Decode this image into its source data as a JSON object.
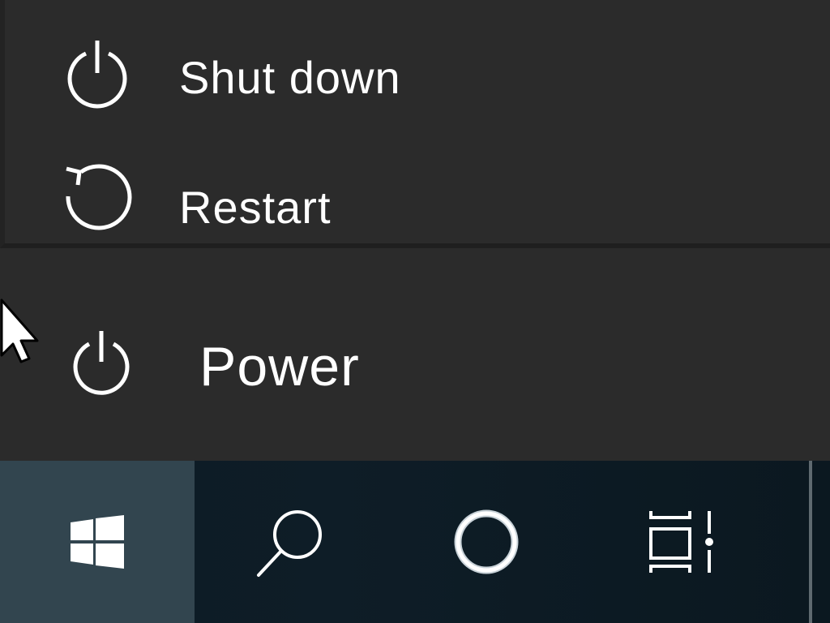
{
  "flyout": {
    "items": [
      {
        "label": "Shut down",
        "icon": "power-icon"
      },
      {
        "label": "Restart",
        "icon": "restart-icon"
      }
    ]
  },
  "start_menu": {
    "power": {
      "label": "Power",
      "icon": "power-icon"
    }
  },
  "taskbar": {
    "buttons": [
      {
        "name": "start",
        "icon": "windows-logo-icon"
      },
      {
        "name": "search",
        "icon": "search-icon"
      },
      {
        "name": "cortana",
        "icon": "cortana-ring-icon"
      },
      {
        "name": "task-view",
        "icon": "task-view-icon"
      }
    ]
  },
  "colors": {
    "menu_background": "#2b2b2b",
    "taskbar_background": "#0e1d27",
    "start_button_highlight": "#32454f",
    "foreground": "#ffffff"
  }
}
